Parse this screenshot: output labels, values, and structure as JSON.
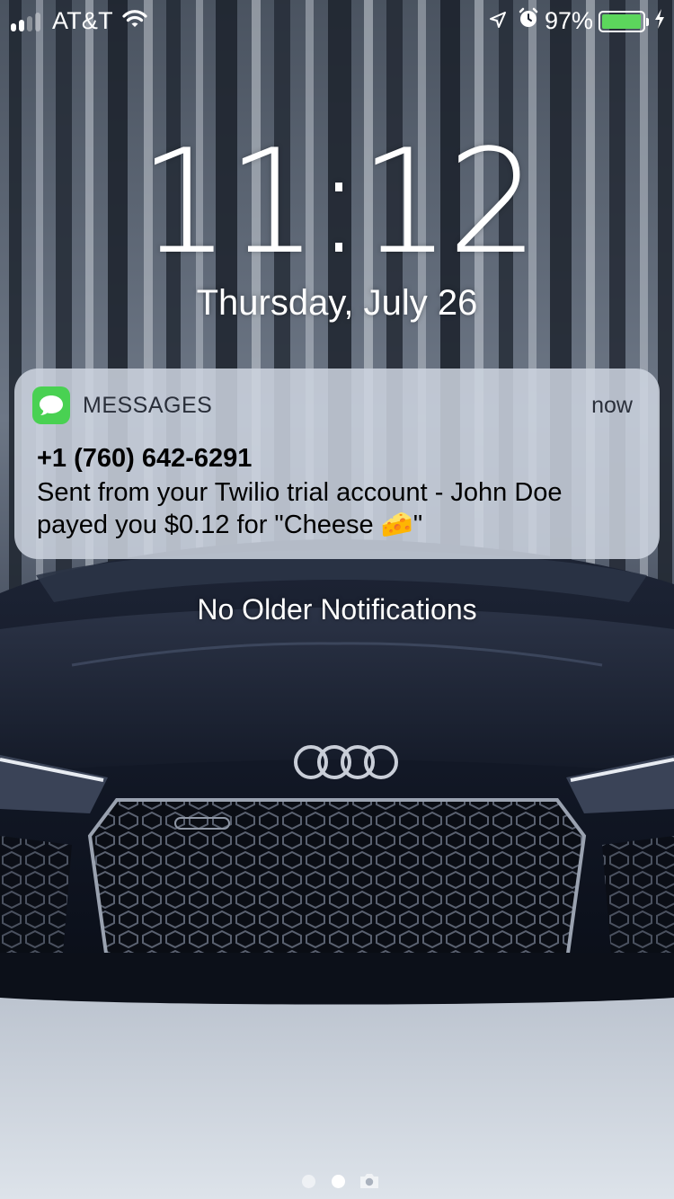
{
  "status_bar": {
    "carrier": "AT&T",
    "signal_bars_active": 2,
    "signal_bars_total": 4,
    "battery_percent": "97%",
    "battery_level": 0.97,
    "icons": [
      "wifi-icon",
      "location-arrow-icon",
      "alarm-icon",
      "battery-icon",
      "charging-bolt-icon"
    ]
  },
  "lock_screen": {
    "time": "11:12",
    "date": "Thursday, July 26",
    "no_older_text": "No Older Notifications"
  },
  "notification": {
    "app_name": "MESSAGES",
    "timestamp": "now",
    "sender": "+1 (760) 642-6291",
    "body": "Sent from your Twilio trial account - John Doe payed you $0.12 for \"Cheese 🧀\"",
    "app_icon": "messages-bubble-icon",
    "app_icon_color": "#49d152"
  },
  "page_indicator": {
    "pages": 2,
    "active_index": 1,
    "trailing_icon": "camera-icon"
  },
  "colors": {
    "battery_fill": "#5cd65c",
    "notification_bg": "#cdd4e0"
  }
}
